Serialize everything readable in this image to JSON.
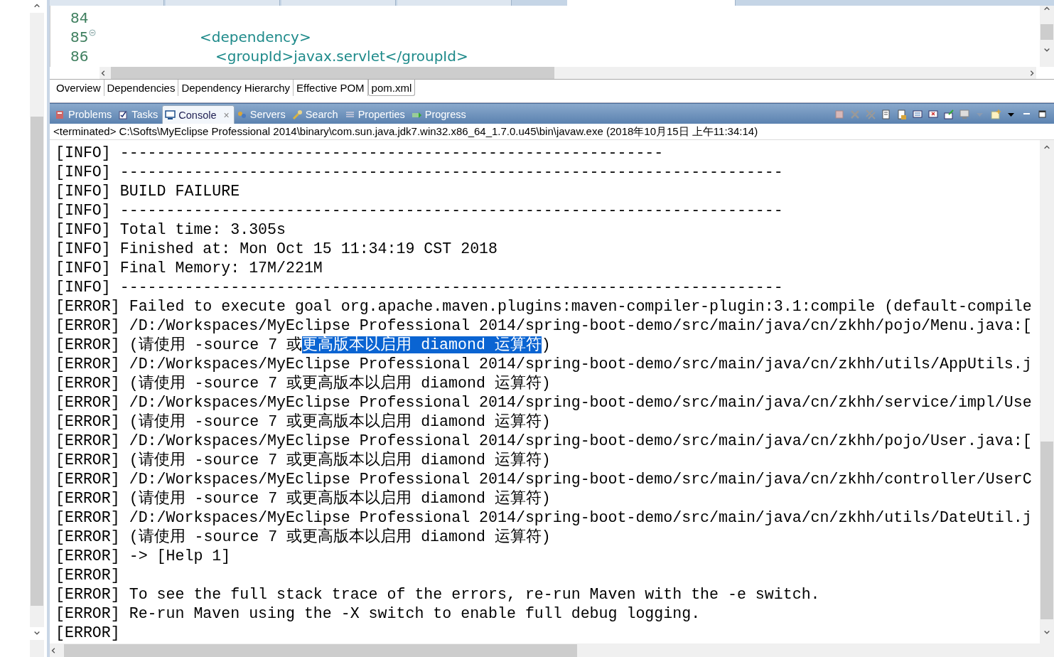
{
  "editor": {
    "tabs": [
      {
        "selected": false
      },
      {
        "selected": false
      },
      {
        "selected": false
      },
      {
        "selected": false
      },
      {
        "selected": true
      }
    ],
    "lines": [
      {
        "number": "84",
        "fold": false
      },
      {
        "number": "85",
        "code": "<dependency>",
        "fold": true
      },
      {
        "number": "86",
        "code": "<groupId>javax.servlet</groupId>",
        "fold": false
      }
    ],
    "page_tabs": [
      {
        "label": "Overview",
        "selected": false
      },
      {
        "label": "Dependencies",
        "selected": false
      },
      {
        "label": "Dependency Hierarchy",
        "selected": false
      },
      {
        "label": "Effective POM",
        "selected": false
      },
      {
        "label": "pom.xml",
        "selected": true
      }
    ]
  },
  "views": {
    "tabs": [
      {
        "label": "Problems",
        "kind": "problems",
        "selected": false
      },
      {
        "label": "Tasks",
        "kind": "tasks",
        "selected": false
      },
      {
        "label": "Console",
        "kind": "console",
        "selected": true
      },
      {
        "label": "Servers",
        "kind": "servers",
        "selected": false
      },
      {
        "label": "Search",
        "kind": "search",
        "selected": false
      },
      {
        "label": "Properties",
        "kind": "properties",
        "selected": false
      },
      {
        "label": "Progress",
        "kind": "progress",
        "selected": false
      }
    ],
    "close": "×"
  },
  "console": {
    "header": "<terminated> C:\\Softs\\MyEclipse Professional 2014\\binary\\com.sun.java.jdk7.win32.x86_64_1.7.0.u45\\bin\\javaw.exe (2018年10月15日 上午11:34:14)",
    "lines": [
      {
        "segments": [
          {
            "text": "[INFO] -----------------------------------------------------------",
            "selected": false
          }
        ]
      },
      {
        "segments": [
          {
            "text": "[INFO] ------------------------------------------------------------------------",
            "selected": false
          }
        ]
      },
      {
        "segments": [
          {
            "text": "[INFO] BUILD FAILURE",
            "selected": false
          }
        ]
      },
      {
        "segments": [
          {
            "text": "[INFO] ------------------------------------------------------------------------",
            "selected": false
          }
        ]
      },
      {
        "segments": [
          {
            "text": "[INFO] Total time: 3.305s",
            "selected": false
          }
        ]
      },
      {
        "segments": [
          {
            "text": "[INFO] Finished at: Mon Oct 15 11:34:19 CST 2018",
            "selected": false
          }
        ]
      },
      {
        "segments": [
          {
            "text": "[INFO] Final Memory: 17M/221M",
            "selected": false
          }
        ]
      },
      {
        "segments": [
          {
            "text": "[INFO] ------------------------------------------------------------------------",
            "selected": false
          }
        ]
      },
      {
        "segments": [
          {
            "text": "[ERROR] Failed to execute goal org.apache.maven.plugins:maven-compiler-plugin:3.1:compile (default-compile",
            "selected": false
          }
        ]
      },
      {
        "segments": [
          {
            "text": "[ERROR] /D:/Workspaces/MyEclipse Professional 2014/spring-boot-demo/src/main/java/cn/zkhh/pojo/Menu.java:[",
            "selected": false
          }
        ]
      },
      {
        "segments": [
          {
            "text": "[ERROR] (请使用 -source 7 或",
            "selected": false
          },
          {
            "text": "更高版本以启用 diamond 运算符",
            "selected": true
          },
          {
            "text": ")",
            "selected": false
          }
        ]
      },
      {
        "segments": [
          {
            "text": "[ERROR] /D:/Workspaces/MyEclipse Professional 2014/spring-boot-demo/src/main/java/cn/zkhh/utils/AppUtils.j",
            "selected": false
          }
        ]
      },
      {
        "segments": [
          {
            "text": "[ERROR] (请使用 -source 7 或更高版本以启用 diamond 运算符)",
            "selected": false
          }
        ]
      },
      {
        "segments": [
          {
            "text": "[ERROR] /D:/Workspaces/MyEclipse Professional 2014/spring-boot-demo/src/main/java/cn/zkhh/service/impl/Use",
            "selected": false
          }
        ]
      },
      {
        "segments": [
          {
            "text": "[ERROR] (请使用 -source 7 或更高版本以启用 diamond 运算符)",
            "selected": false
          }
        ]
      },
      {
        "segments": [
          {
            "text": "[ERROR] /D:/Workspaces/MyEclipse Professional 2014/spring-boot-demo/src/main/java/cn/zkhh/pojo/User.java:[",
            "selected": false
          }
        ]
      },
      {
        "segments": [
          {
            "text": "[ERROR] (请使用 -source 7 或更高版本以启用 diamond 运算符)",
            "selected": false
          }
        ]
      },
      {
        "segments": [
          {
            "text": "[ERROR] /D:/Workspaces/MyEclipse Professional 2014/spring-boot-demo/src/main/java/cn/zkhh/controller/UserC",
            "selected": false
          }
        ]
      },
      {
        "segments": [
          {
            "text": "[ERROR] (请使用 -source 7 或更高版本以启用 diamond 运算符)",
            "selected": false
          }
        ]
      },
      {
        "segments": [
          {
            "text": "[ERROR] /D:/Workspaces/MyEclipse Professional 2014/spring-boot-demo/src/main/java/cn/zkhh/utils/DateUtil.j",
            "selected": false
          }
        ]
      },
      {
        "segments": [
          {
            "text": "[ERROR] (请使用 -source 7 或更高版本以启用 diamond 运算符)",
            "selected": false
          }
        ]
      },
      {
        "segments": [
          {
            "text": "[ERROR] -> [Help 1]",
            "selected": false
          }
        ]
      },
      {
        "segments": [
          {
            "text": "[ERROR]",
            "selected": false
          }
        ]
      },
      {
        "segments": [
          {
            "text": "[ERROR] To see the full stack trace of the errors, re-run Maven with the -e switch.",
            "selected": false
          }
        ]
      },
      {
        "segments": [
          {
            "text": "[ERROR] Re-run Maven using the -X switch to enable full debug logging.",
            "selected": false
          }
        ]
      },
      {
        "segments": [
          {
            "text": "[ERROR]",
            "selected": false
          }
        ]
      }
    ]
  }
}
